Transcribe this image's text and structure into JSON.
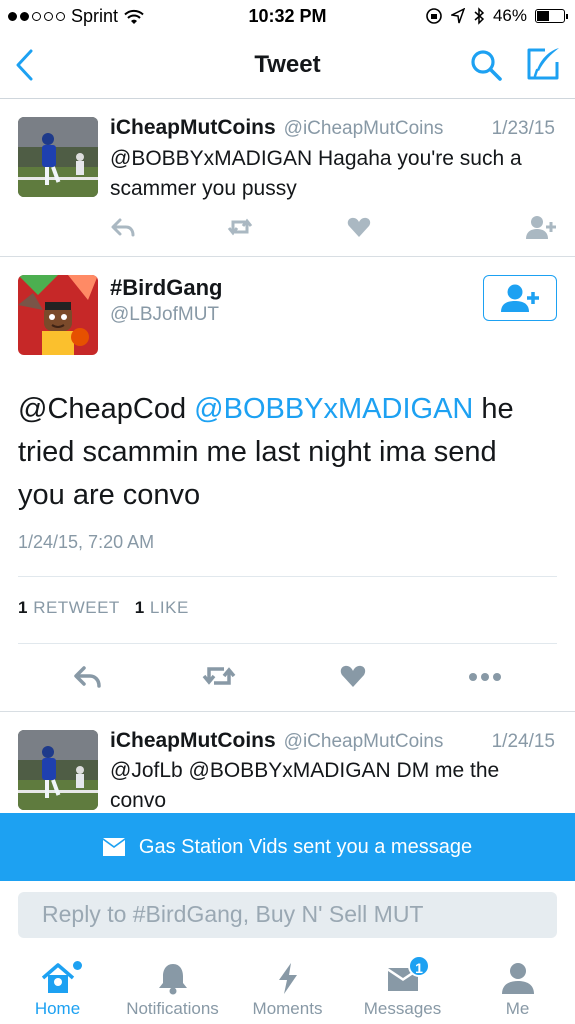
{
  "status_bar": {
    "carrier": "Sprint",
    "time": "10:32 PM",
    "battery": "46%",
    "battery_level": 0.46,
    "signal_bars_filled": 2,
    "signal_bars_total": 5
  },
  "nav": {
    "title": "Tweet"
  },
  "tweet1": {
    "name": "iCheapMutCoins",
    "handle": "@iCheapMutCoins",
    "date": "1/23/15",
    "text": "@BOBBYxMADIGAN Hagaha you're such a scammer you pussy"
  },
  "detail": {
    "name": "#BirdGang",
    "handle": "@LBJofMUT",
    "text_part1": "@CheapCod ",
    "mention": "@BOBBYxMADIGAN",
    "text_part2": " he tried scammin me last night ima send you are convo",
    "timestamp": "1/24/15, 7:20 AM",
    "retweet_count": "1",
    "retweet_label": " RETWEET",
    "like_count": "1",
    "like_label": " LIKE"
  },
  "tweet3": {
    "name": "iCheapMutCoins",
    "handle": "@iCheapMutCoins",
    "date": "1/24/15",
    "text": "@JofLb @BOBBYxMADIGAN DM me the convo"
  },
  "banner": {
    "text": "Gas Station Vids sent you a message"
  },
  "reply": {
    "placeholder": "Reply to #BirdGang, Buy N' Sell MUT"
  },
  "tabs": [
    {
      "label": "Home",
      "icon": "home-icon"
    },
    {
      "label": "Notifications",
      "icon": "bell-icon"
    },
    {
      "label": "Moments",
      "icon": "lightning-icon"
    },
    {
      "label": "Messages",
      "icon": "envelope-icon",
      "badge": "1"
    },
    {
      "label": "Me",
      "icon": "person-icon"
    }
  ],
  "colors": {
    "accent": "#1da1f2",
    "muted": "#8899a6",
    "text": "#14171a"
  }
}
